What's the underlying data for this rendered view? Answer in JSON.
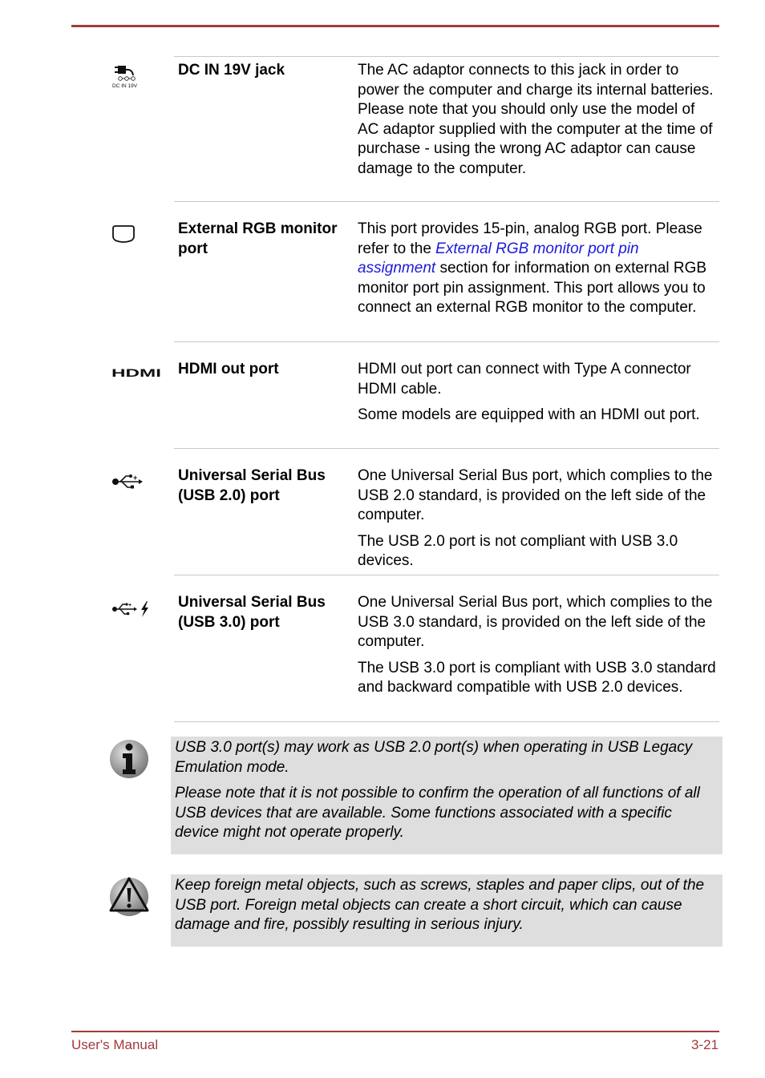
{
  "rows": [
    {
      "icon": "dc-in-icon",
      "icon_label": "DC IN 19V",
      "term": "DC IN 19V jack",
      "desc": [
        "The AC adaptor connects to this jack in order to power the computer and charge its internal batteries. Please note that you should only use the model of AC adaptor supplied with the computer at the time of purchase - using the wrong AC adaptor can cause damage to the computer."
      ]
    },
    {
      "icon": "rgb-monitor-port-icon",
      "term": "External RGB monitor port",
      "desc_pre": "This port provides 15-pin, analog RGB port. Please refer to the ",
      "desc_link": "External RGB monitor port pin assignment",
      "desc_post": " section for information on external RGB monitor port pin assignment. This port allows you to connect an external RGB monitor to the computer."
    },
    {
      "icon": "hdmi-icon",
      "term": "HDMI out port",
      "desc": [
        "HDMI out port can connect with Type A connector HDMI cable.",
        "Some models are equipped with an HDMI out port."
      ]
    },
    {
      "icon": "usb-icon",
      "term": "Universal Serial Bus (USB 2.0) port",
      "desc": [
        "One Universal Serial Bus port, which complies to the USB 2.0 standard, is provided on the left side of the computer.",
        "The USB 2.0 port is not compliant with USB 3.0 devices."
      ]
    },
    {
      "icon": "usb-sleep-charge-icon",
      "term": "Universal Serial Bus (USB 3.0) port",
      "desc": [
        "One Universal Serial Bus port, which complies to the USB 3.0 standard, is provided on the left side of the computer.",
        "The USB 3.0 port is compliant with USB 3.0 standard and backward compatible with USB 2.0 devices."
      ]
    }
  ],
  "info_note": [
    "USB 3.0 port(s) may work as USB 2.0 port(s) when operating in USB Legacy Emulation mode.",
    "Please note that it is not possible to confirm the operation of all functions of all USB devices that are available. Some functions associated with a specific device might not operate properly."
  ],
  "warning_note": [
    "Keep foreign metal objects, such as screws, staples and paper clips, out of the USB port. Foreign metal objects can create a short circuit, which can cause damage and fire, possibly resulting in serious injury."
  ],
  "footer": {
    "left": "User's Manual",
    "right": "3-21"
  },
  "colors": {
    "accent": "#a33a3a",
    "link": "#1a1adb",
    "note_bg": "#dedede"
  }
}
